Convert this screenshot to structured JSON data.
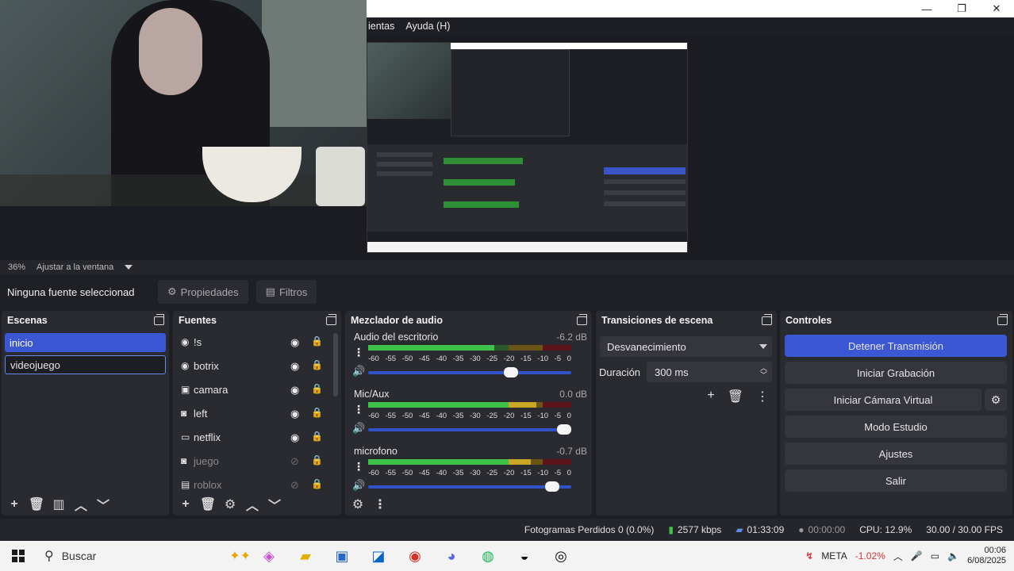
{
  "window": {
    "minimize": "—",
    "maximize": "❐",
    "close": "✕"
  },
  "menu": [
    "ientas",
    "Ayuda (H)"
  ],
  "zoom": {
    "percent": "36%",
    "fit": "Ajustar a la ventana"
  },
  "context": {
    "label": "Ninguna fuente seleccionad",
    "properties": "Propiedades",
    "filters": "Filtros"
  },
  "scenes": {
    "title": "Escenas",
    "items": [
      "inicio",
      "videojuego"
    ]
  },
  "sources": {
    "title": "Fuentes",
    "items": [
      {
        "label": "!s",
        "icon": "globe-icon",
        "glyph": "◉",
        "visible": true,
        "locked": true
      },
      {
        "label": "botrix",
        "icon": "globe-icon",
        "glyph": "◉",
        "visible": true,
        "locked": true
      },
      {
        "label": "camara",
        "icon": "camera-icon",
        "glyph": "▣",
        "visible": true,
        "locked": false
      },
      {
        "label": "left",
        "icon": "gamepad-icon",
        "glyph": "◙",
        "visible": true,
        "locked": false
      },
      {
        "label": "netflix",
        "icon": "monitor-icon",
        "glyph": "▭",
        "visible": true,
        "locked": false
      },
      {
        "label": "juego",
        "icon": "gamepad-icon",
        "glyph": "◙",
        "visible": false,
        "locked": false
      },
      {
        "label": "roblox",
        "icon": "window-icon",
        "glyph": "▤",
        "visible": false,
        "locked": false
      }
    ]
  },
  "mixer": {
    "title": "Mezclador de audio",
    "scale": [
      "-60",
      "-55",
      "-50",
      "-45",
      "-40",
      "-35",
      "-30",
      "-25",
      "-20",
      "-15",
      "-10",
      "-5",
      "0"
    ],
    "channels": [
      {
        "name": "Audio del escritorio",
        "db": "-6.2 dB",
        "level": 0.62,
        "volume": 0.74
      },
      {
        "name": "Mic/Aux",
        "db": "0.0 dB",
        "level": 0.83,
        "volume": 1.0
      },
      {
        "name": "microfono",
        "db": "-0.7 dB",
        "level": 0.8,
        "volume": 0.94
      }
    ]
  },
  "transitions": {
    "title": "Transiciones de escena",
    "selected": "Desvanecimiento",
    "duration_label": "Duración",
    "duration": "300 ms"
  },
  "controls": {
    "title": "Controles",
    "stop_stream": "Detener Transmisión",
    "start_recording": "Iniciar Grabación",
    "virtual_cam": "Iniciar Cámara Virtual",
    "studio_mode": "Modo Estudio",
    "settings": "Ajustes",
    "exit": "Salir"
  },
  "status": {
    "dropped": "Fotogramas Perdidos 0 (0.0%)",
    "bitrate": "2577 kbps",
    "stream_time": "01:33:09",
    "rec_time": "00:00:00",
    "cpu": "CPU: 12.9%",
    "fps": "30.00 / 30.00 FPS"
  },
  "taskbar": {
    "search": "Buscar",
    "stock_name": "META",
    "stock_change": "-1.02%",
    "time": "00:06",
    "date": "6/08/2025"
  },
  "colors": {
    "accent": "#3b57d4",
    "meter_green": "#3fc14c",
    "meter_yellow": "#c9a524",
    "meter_red": "#b01f2b",
    "stock_red": "#d13438"
  }
}
